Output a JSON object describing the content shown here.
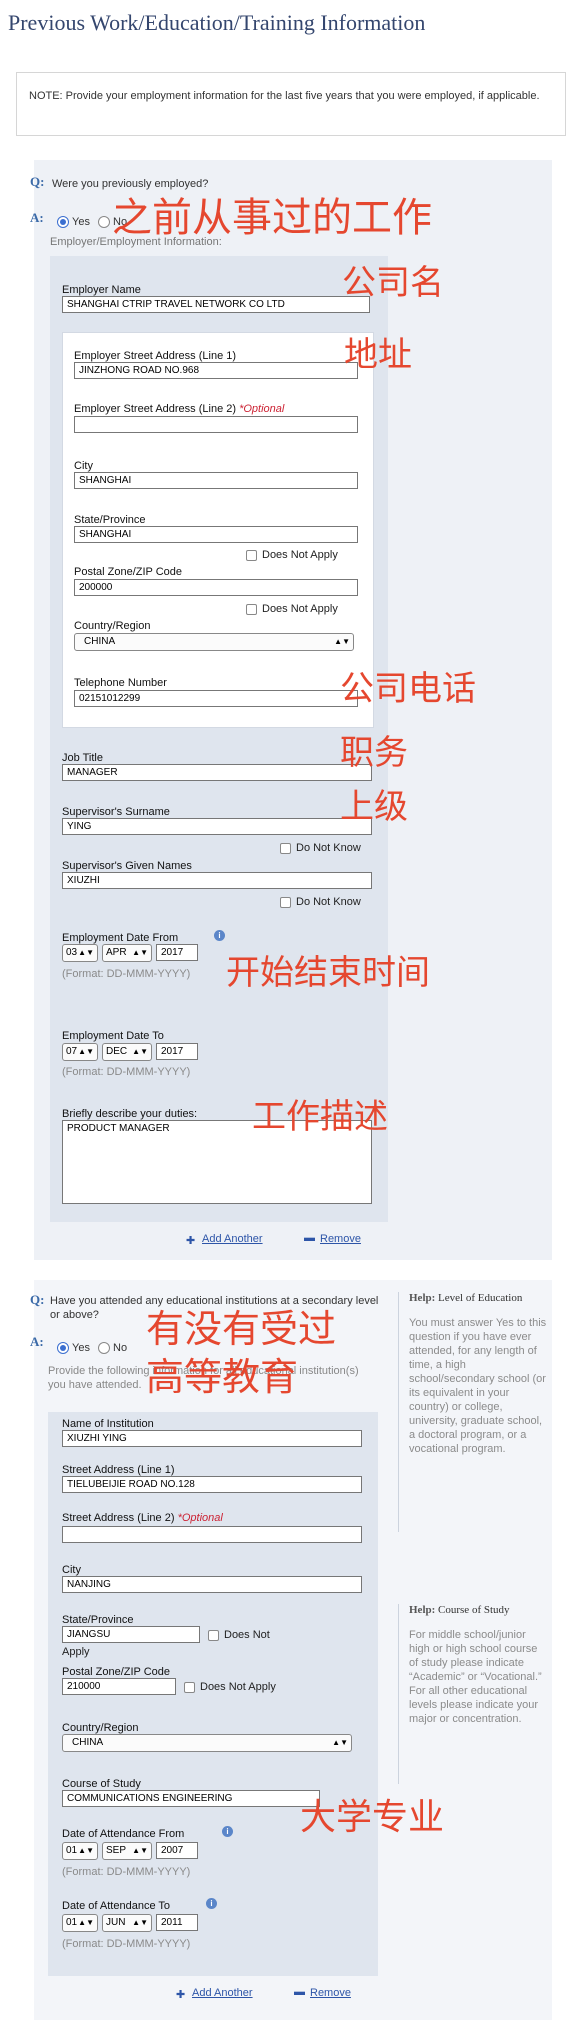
{
  "page_title": "Previous Work/Education/Training Information",
  "note": "NOTE: Provide your employment information for the last five years that you were employed, if applicable.",
  "employment": {
    "q_marker": "Q:",
    "a_marker": "A:",
    "question": "Were you previously employed?",
    "yes_label": "Yes",
    "no_label": "No",
    "subheading": "Employer/Employment Information:",
    "employer_name_label": "Employer Name",
    "employer_name_value": "SHANGHAI CTRIP TRAVEL NETWORK CO LTD",
    "street1_label": "Employer Street Address (Line 1)",
    "street1_value": "JINZHONG ROAD NO.968",
    "street2_label": "Employer Street Address (Line 2)",
    "optional": "*Optional",
    "city_label": "City",
    "city_value": "SHANGHAI",
    "state_label": "State/Province",
    "state_value": "SHANGHAI",
    "does_not_apply": "Does Not Apply",
    "zip_label": "Postal Zone/ZIP Code",
    "zip_value": "200000",
    "country_label": "Country/Region",
    "country_value": "CHINA",
    "phone_label": "Telephone Number",
    "phone_value": "02151012299",
    "job_title_label": "Job Title",
    "job_title_value": "MANAGER",
    "sup_surname_label": "Supervisor's Surname",
    "sup_surname_value": "YING",
    "do_not_know": "Do Not Know",
    "sup_given_label": "Supervisor's Given Names",
    "sup_given_value": "XIUZHI",
    "from_label": "Employment Date From",
    "from_day": "03",
    "from_month": "APR",
    "from_year": "2017",
    "format_hint": "(Format: DD-MMM-YYYY)",
    "to_label": "Employment Date To",
    "to_day": "07",
    "to_month": "DEC",
    "to_year": "2017",
    "duties_label": "Briefly describe your duties:",
    "duties_value": "PRODUCT MANAGER",
    "add_another": "Add Another",
    "remove": "Remove"
  },
  "education": {
    "question": "Have you attended any educational institutions at a secondary level or above?",
    "yes_label": "Yes",
    "no_label": "No",
    "provide_text": "Provide the following information for all educational institution(s) you have attended.",
    "inst_label": "Name of Institution",
    "inst_value": "XIUZHI YING",
    "street1_label": "Street Address (Line 1)",
    "street1_value": "TIELUBEIJIE ROAD NO.128",
    "street2_label": "Street Address (Line 2)",
    "optional": "*Optional",
    "city_label": "City",
    "city_value": "NANJING",
    "state_label": "State/Province",
    "state_value": "JIANGSU",
    "does_not": "Does Not",
    "apply": "Apply",
    "zip_label": "Postal Zone/ZIP Code",
    "zip_value": "210000",
    "does_not_apply": "Does Not Apply",
    "country_label": "Country/Region",
    "country_value": "CHINA",
    "course_label": "Course of Study",
    "course_value": "COMMUNICATIONS ENGINEERING",
    "from_label": "Date of Attendance From",
    "from_day": "01",
    "from_month": "SEP",
    "from_year": "2007",
    "format_hint": "(Format: DD-MMM-YYYY)",
    "to_label": "Date of Attendance To",
    "to_day": "01",
    "to_month": "JUN",
    "to_year": "2011",
    "add_another": "Add Another",
    "remove": "Remove"
  },
  "help": {
    "h1_prefix": "Help:",
    "h1_title": "Level of Education",
    "h1_text": "You must answer Yes to this question if you have ever attended, for any length of time, a high school/secondary school (or its equivalent in your country) or college, university, graduate school, a doctoral program, or a vocational program.",
    "h2_prefix": "Help:",
    "h2_title": "Course of Study",
    "h2_text": "For middle school/junior high or high school course of study please indicate “Academic” or “Vocational.” For all other educational levels please indicate your major or concentration."
  },
  "annotations": {
    "prev_work": "之前从事过的工作",
    "company_name": "公司名",
    "address": "地址",
    "company_phone": "公司电话",
    "position": "职务",
    "supervisor": "上级",
    "start_end": "开始结束时间",
    "job_desc": "工作描述",
    "edu_q1": "有没有受过",
    "edu_q2": "高等教育",
    "major": "大学专业"
  }
}
